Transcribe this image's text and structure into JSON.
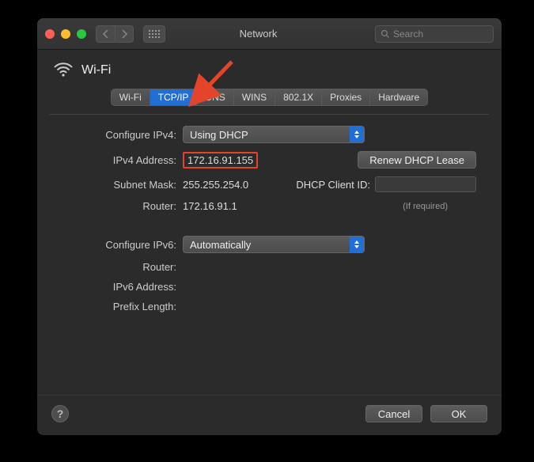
{
  "window": {
    "title": "Network",
    "search_placeholder": "Search"
  },
  "header": {
    "interface": "Wi-Fi"
  },
  "tabs": [
    {
      "id": "wifi",
      "label": "Wi-Fi",
      "active": false
    },
    {
      "id": "tcpip",
      "label": "TCP/IP",
      "active": true
    },
    {
      "id": "dns",
      "label": "DNS",
      "active": false
    },
    {
      "id": "wins",
      "label": "WINS",
      "active": false
    },
    {
      "id": "8021x",
      "label": "802.1X",
      "active": false
    },
    {
      "id": "proxies",
      "label": "Proxies",
      "active": false
    },
    {
      "id": "hardware",
      "label": "Hardware",
      "active": false
    }
  ],
  "ipv4": {
    "configure_label": "Configure IPv4:",
    "configure_value": "Using DHCP",
    "address_label": "IPv4 Address:",
    "address_value": "172.16.91.155",
    "subnet_label": "Subnet Mask:",
    "subnet_value": "255.255.254.0",
    "router_label": "Router:",
    "router_value": "172.16.91.1",
    "renew_button": "Renew DHCP Lease",
    "dhcp_client_label": "DHCP Client ID:",
    "dhcp_client_hint": "(If required)"
  },
  "ipv6": {
    "configure_label": "Configure IPv6:",
    "configure_value": "Automatically",
    "router_label": "Router:",
    "address_label": "IPv6 Address:",
    "prefix_label": "Prefix Length:"
  },
  "footer": {
    "cancel": "Cancel",
    "ok": "OK",
    "help": "?"
  }
}
